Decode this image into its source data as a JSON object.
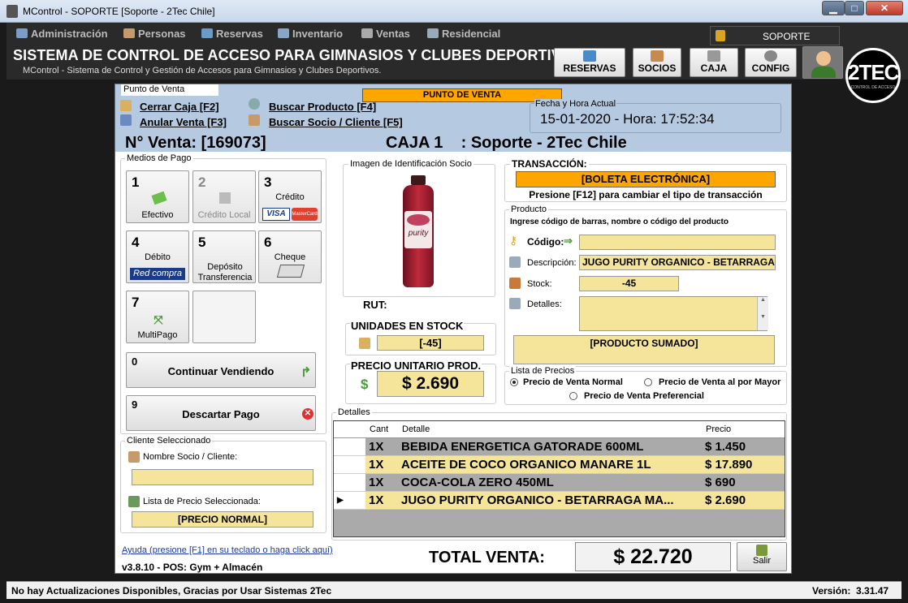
{
  "window": {
    "title": "MControl - SOPORTE [Soporte - 2Tec Chile]",
    "minimize": "▁",
    "maximize": "□",
    "close": "✕"
  },
  "menu": [
    {
      "label": "Administración",
      "icon": "users-icon"
    },
    {
      "label": "Personas",
      "icon": "person-icon"
    },
    {
      "label": "Reservas",
      "icon": "calendar-icon"
    },
    {
      "label": "Inventario",
      "icon": "list-icon"
    },
    {
      "label": "Ventas",
      "icon": "cart-icon"
    },
    {
      "label": "Residencial",
      "icon": "building-icon"
    }
  ],
  "header": {
    "title": "SISTEMA DE CONTROL DE ACCESO PARA GIMNASIOS Y CLUBES DEPORTIVO",
    "subtitle": "MControl - Sistema de Control y Gestión de Accesos para Gimnasios y Clubes Deportivos.",
    "user": "SOPORTE",
    "logo_text": "2TEC",
    "logo_small": "CONTROL DE ACCESO",
    "buttons": [
      "RESERVAS",
      "SOCIOS",
      "CAJA",
      "CONFIG"
    ]
  },
  "pos": {
    "tab": "Punto de Venta",
    "banner": "PUNTO DE VENTA",
    "links": {
      "cerrar": "Cerrar Caja [F2]",
      "anular": "Anular Venta [F3]",
      "buscar_producto": "Buscar Producto [F4]",
      "buscar_socio": "Buscar Socio / Cliente [F5]"
    },
    "datetime_label": "Fecha y Hora Actual",
    "datetime_value": "15-01-2020 - Hora: 17:52:34",
    "venta": "N° Venta:  [169073]",
    "caja": "CAJA 1    : Soporte - 2Tec Chile"
  },
  "payment": {
    "label": "Medios de Pago",
    "methods": [
      {
        "num": "1",
        "name": "Efectivo",
        "disabled": false
      },
      {
        "num": "2",
        "name": "Crédito Local",
        "disabled": true
      },
      {
        "num": "3",
        "name": "Crédito",
        "disabled": false
      },
      {
        "num": "4",
        "name": "Débito",
        "disabled": false
      },
      {
        "num": "5",
        "name": "Depósito Transferencia",
        "disabled": false
      },
      {
        "num": "6",
        "name": "Cheque",
        "disabled": false
      },
      {
        "num": "7",
        "name": "MultiPago",
        "disabled": false
      }
    ],
    "visa": "VISA",
    "mastercard": "MasterCard",
    "redcompra": "Red compra",
    "continuar": {
      "num": "0",
      "label": "Continuar Vendiendo"
    },
    "descartar": {
      "num": "9",
      "label": "Descartar Pago"
    }
  },
  "cliente": {
    "label": "Cliente Seleccionado",
    "nombre_label": "Nombre Socio / Cliente:",
    "nombre_value": "",
    "lista_label": "Lista de Precio Seleccionada:",
    "lista_value": "[PRECIO NORMAL]"
  },
  "imagen": {
    "label": "Imagen de Identificación Socio",
    "brand": "purity",
    "rut_label": "RUT:",
    "stock_label": "UNIDADES EN STOCK",
    "stock_value": "[-45]",
    "precio_label": "PRECIO UNITARIO PROD.",
    "precio_value": "$ 2.690"
  },
  "transaccion": {
    "label": "TRANSACCIÓN:",
    "value": "[BOLETA ELECTRÓNICA]",
    "hint": "Presione [F12] para cambiar el tipo de transacción"
  },
  "producto": {
    "label": "Producto",
    "hint": "Ingrese código de barras, nombre o código del producto",
    "codigo_label": "Código:",
    "codigo_value": "",
    "descripcion_label": "Descripción:",
    "descripcion_value": "JUGO PURITY ORGANICO - BETARRAGA",
    "stock_label": "Stock:",
    "stock_value": "-45",
    "detalles_label": "Detalles:",
    "detalles_value": "",
    "status": "[PRODUCTO SUMADO]"
  },
  "precios": {
    "label": "Lista de Precios",
    "options": [
      "Precio de Venta Normal",
      "Precio de Venta al por Mayor",
      "Precio de Venta Preferencial"
    ],
    "selected": 0
  },
  "detalles": {
    "label": "Detalles",
    "headers": [
      "Cant",
      "Detalle",
      "Precio"
    ],
    "rows": [
      {
        "cant": "1X",
        "detalle": "BEBIDA ENERGETICA GATORADE 600ML",
        "precio": "$ 1.450"
      },
      {
        "cant": "1X",
        "detalle": "ACEITE DE COCO ORGANICO MANARE 1L",
        "precio": "$ 17.890"
      },
      {
        "cant": "1X",
        "detalle": "COCA-COLA ZERO 450ML",
        "precio": "$ 690"
      },
      {
        "cant": "1X",
        "detalle": "JUGO PURITY ORGANICO - BETARRAGA MA...",
        "precio": "$ 2.690"
      }
    ]
  },
  "footer": {
    "ayuda": "Ayuda (presione [F1] en su teclado o haga click aquí)",
    "version_pos": "v3.8.10 - POS: Gym + Almacén",
    "total_label": "TOTAL VENTA:",
    "total_value": "$ 22.720",
    "salir": "Salir"
  },
  "statusbar": {
    "message": "No hay Actualizaciones Disponibles, Gracias por Usar Sistemas 2Tec",
    "version": "Versión:  3.31.47"
  },
  "colors": {
    "orange": "#ffa500",
    "yellow_field": "#f5e59a",
    "band": "#b5c9e0"
  }
}
